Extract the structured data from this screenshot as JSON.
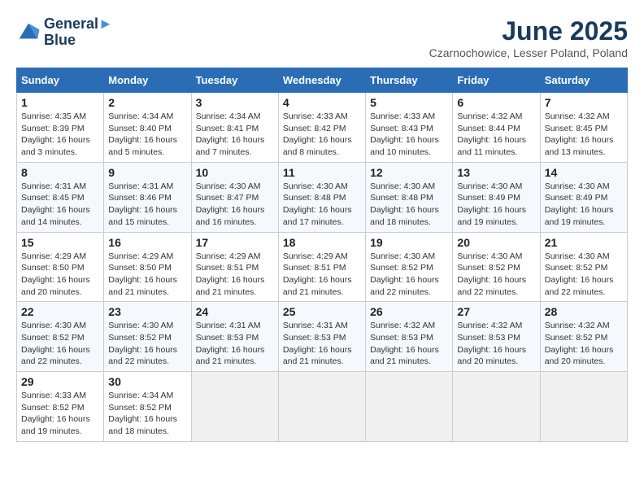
{
  "header": {
    "logo_line1": "General",
    "logo_line2": "Blue",
    "month_title": "June 2025",
    "location": "Czarnochowice, Lesser Poland, Poland"
  },
  "columns": [
    "Sunday",
    "Monday",
    "Tuesday",
    "Wednesday",
    "Thursday",
    "Friday",
    "Saturday"
  ],
  "weeks": [
    [
      {
        "day": "1",
        "sunrise": "Sunrise: 4:35 AM",
        "sunset": "Sunset: 8:39 PM",
        "daylight": "Daylight: 16 hours and 3 minutes."
      },
      {
        "day": "2",
        "sunrise": "Sunrise: 4:34 AM",
        "sunset": "Sunset: 8:40 PM",
        "daylight": "Daylight: 16 hours and 5 minutes."
      },
      {
        "day": "3",
        "sunrise": "Sunrise: 4:34 AM",
        "sunset": "Sunset: 8:41 PM",
        "daylight": "Daylight: 16 hours and 7 minutes."
      },
      {
        "day": "4",
        "sunrise": "Sunrise: 4:33 AM",
        "sunset": "Sunset: 8:42 PM",
        "daylight": "Daylight: 16 hours and 8 minutes."
      },
      {
        "day": "5",
        "sunrise": "Sunrise: 4:33 AM",
        "sunset": "Sunset: 8:43 PM",
        "daylight": "Daylight: 16 hours and 10 minutes."
      },
      {
        "day": "6",
        "sunrise": "Sunrise: 4:32 AM",
        "sunset": "Sunset: 8:44 PM",
        "daylight": "Daylight: 16 hours and 11 minutes."
      },
      {
        "day": "7",
        "sunrise": "Sunrise: 4:32 AM",
        "sunset": "Sunset: 8:45 PM",
        "daylight": "Daylight: 16 hours and 13 minutes."
      }
    ],
    [
      {
        "day": "8",
        "sunrise": "Sunrise: 4:31 AM",
        "sunset": "Sunset: 8:45 PM",
        "daylight": "Daylight: 16 hours and 14 minutes."
      },
      {
        "day": "9",
        "sunrise": "Sunrise: 4:31 AM",
        "sunset": "Sunset: 8:46 PM",
        "daylight": "Daylight: 16 hours and 15 minutes."
      },
      {
        "day": "10",
        "sunrise": "Sunrise: 4:30 AM",
        "sunset": "Sunset: 8:47 PM",
        "daylight": "Daylight: 16 hours and 16 minutes."
      },
      {
        "day": "11",
        "sunrise": "Sunrise: 4:30 AM",
        "sunset": "Sunset: 8:48 PM",
        "daylight": "Daylight: 16 hours and 17 minutes."
      },
      {
        "day": "12",
        "sunrise": "Sunrise: 4:30 AM",
        "sunset": "Sunset: 8:48 PM",
        "daylight": "Daylight: 16 hours and 18 minutes."
      },
      {
        "day": "13",
        "sunrise": "Sunrise: 4:30 AM",
        "sunset": "Sunset: 8:49 PM",
        "daylight": "Daylight: 16 hours and 19 minutes."
      },
      {
        "day": "14",
        "sunrise": "Sunrise: 4:30 AM",
        "sunset": "Sunset: 8:49 PM",
        "daylight": "Daylight: 16 hours and 19 minutes."
      }
    ],
    [
      {
        "day": "15",
        "sunrise": "Sunrise: 4:29 AM",
        "sunset": "Sunset: 8:50 PM",
        "daylight": "Daylight: 16 hours and 20 minutes."
      },
      {
        "day": "16",
        "sunrise": "Sunrise: 4:29 AM",
        "sunset": "Sunset: 8:50 PM",
        "daylight": "Daylight: 16 hours and 21 minutes."
      },
      {
        "day": "17",
        "sunrise": "Sunrise: 4:29 AM",
        "sunset": "Sunset: 8:51 PM",
        "daylight": "Daylight: 16 hours and 21 minutes."
      },
      {
        "day": "18",
        "sunrise": "Sunrise: 4:29 AM",
        "sunset": "Sunset: 8:51 PM",
        "daylight": "Daylight: 16 hours and 21 minutes."
      },
      {
        "day": "19",
        "sunrise": "Sunrise: 4:30 AM",
        "sunset": "Sunset: 8:52 PM",
        "daylight": "Daylight: 16 hours and 22 minutes."
      },
      {
        "day": "20",
        "sunrise": "Sunrise: 4:30 AM",
        "sunset": "Sunset: 8:52 PM",
        "daylight": "Daylight: 16 hours and 22 minutes."
      },
      {
        "day": "21",
        "sunrise": "Sunrise: 4:30 AM",
        "sunset": "Sunset: 8:52 PM",
        "daylight": "Daylight: 16 hours and 22 minutes."
      }
    ],
    [
      {
        "day": "22",
        "sunrise": "Sunrise: 4:30 AM",
        "sunset": "Sunset: 8:52 PM",
        "daylight": "Daylight: 16 hours and 22 minutes."
      },
      {
        "day": "23",
        "sunrise": "Sunrise: 4:30 AM",
        "sunset": "Sunset: 8:52 PM",
        "daylight": "Daylight: 16 hours and 22 minutes."
      },
      {
        "day": "24",
        "sunrise": "Sunrise: 4:31 AM",
        "sunset": "Sunset: 8:53 PM",
        "daylight": "Daylight: 16 hours and 21 minutes."
      },
      {
        "day": "25",
        "sunrise": "Sunrise: 4:31 AM",
        "sunset": "Sunset: 8:53 PM",
        "daylight": "Daylight: 16 hours and 21 minutes."
      },
      {
        "day": "26",
        "sunrise": "Sunrise: 4:32 AM",
        "sunset": "Sunset: 8:53 PM",
        "daylight": "Daylight: 16 hours and 21 minutes."
      },
      {
        "day": "27",
        "sunrise": "Sunrise: 4:32 AM",
        "sunset": "Sunset: 8:53 PM",
        "daylight": "Daylight: 16 hours and 20 minutes."
      },
      {
        "day": "28",
        "sunrise": "Sunrise: 4:32 AM",
        "sunset": "Sunset: 8:52 PM",
        "daylight": "Daylight: 16 hours and 20 minutes."
      }
    ],
    [
      {
        "day": "29",
        "sunrise": "Sunrise: 4:33 AM",
        "sunset": "Sunset: 8:52 PM",
        "daylight": "Daylight: 16 hours and 19 minutes."
      },
      {
        "day": "30",
        "sunrise": "Sunrise: 4:34 AM",
        "sunset": "Sunset: 8:52 PM",
        "daylight": "Daylight: 16 hours and 18 minutes."
      },
      null,
      null,
      null,
      null,
      null
    ]
  ]
}
